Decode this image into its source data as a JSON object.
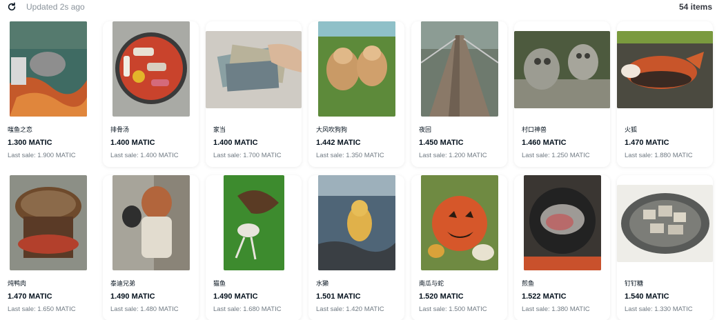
{
  "header": {
    "updated_text": "Updated 2s ago",
    "items_count": "54 items",
    "refresh_icon": "refresh-icon"
  },
  "items": [
    {
      "name": "嗤鱼之恋",
      "price": "1.300 MATIC",
      "last_sale": "Last sale: 1.900 MATIC"
    },
    {
      "name": "排骨汤",
      "price": "1.400 MATIC",
      "last_sale": "Last sale: 1.400 MATIC"
    },
    {
      "name": "家当",
      "price": "1.400 MATIC",
      "last_sale": "Last sale: 1.700 MATIC"
    },
    {
      "name": "大风吹狗狗",
      "price": "1.442 MATIC",
      "last_sale": "Last sale: 1.350 MATIC"
    },
    {
      "name": "夜回",
      "price": "1.450 MATIC",
      "last_sale": "Last sale: 1.200 MATIC"
    },
    {
      "name": "村口神兽",
      "price": "1.460 MATIC",
      "last_sale": "Last sale: 1.250 MATIC"
    },
    {
      "name": "火狐",
      "price": "1.470 MATIC",
      "last_sale": "Last sale: 1.880 MATIC"
    },
    {
      "name": "炖鸭肉",
      "price": "1.470 MATIC",
      "last_sale": "Last sale: 1.650 MATIC"
    },
    {
      "name": "泰迪兄弟",
      "price": "1.490 MATIC",
      "last_sale": "Last sale: 1.480 MATIC"
    },
    {
      "name": "猫鱼",
      "price": "1.490 MATIC",
      "last_sale": "Last sale: 1.680 MATIC"
    },
    {
      "name": "水獭",
      "price": "1.501 MATIC",
      "last_sale": "Last sale: 1.420 MATIC"
    },
    {
      "name": "南瓜与蛇",
      "price": "1.520 MATIC",
      "last_sale": "Last sale: 1.500 MATIC"
    },
    {
      "name": "煎鱼",
      "price": "1.522 MATIC",
      "last_sale": "Last sale: 1.380 MATIC"
    },
    {
      "name": "钉钉糖",
      "price": "1.540 MATIC",
      "last_sale": "Last sale: 1.330 MATIC"
    }
  ]
}
